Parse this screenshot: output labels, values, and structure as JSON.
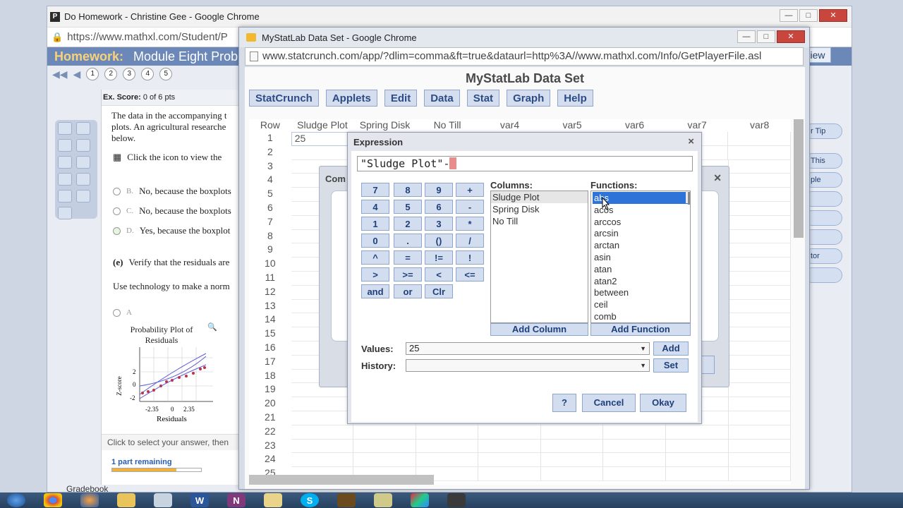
{
  "bg_window": {
    "title": "Do Homework - Christine Gee - Google Chrome",
    "favicon": "P",
    "url": "https://www.mathxl.com/Student/P",
    "hw_label": "Homework:",
    "hw_title": "Module Eight Probl",
    "nav_pages": [
      "1",
      "2",
      "3",
      "4",
      "5"
    ],
    "score_label": "Ex. Score:",
    "score_value": "0 of 6 pts",
    "problem_text": "The data in the accompanying t plots. An agricultural researche below.",
    "icon_text": "Click the icon to view the",
    "options": [
      {
        "letter": "B.",
        "text": "No, because the boxplots"
      },
      {
        "letter": "C.",
        "text": "No, because the boxplots"
      },
      {
        "letter": "D.",
        "text": "Yes, because the boxplot"
      }
    ],
    "part_e_label": "(e)",
    "part_e_text": "Verify that the residuals are",
    "use_tech_text": "Use technology to make a norm",
    "option_a": "A",
    "prob_plot_title": "Probability Plot of Residuals",
    "prob_plot_ylabel": "Z-score",
    "prob_plot_xlabel": "Residuals",
    "prob_plot_yticks": [
      "2",
      "0",
      "-2"
    ],
    "prob_plot_xticks": [
      "-2.35",
      "0",
      "2.35"
    ],
    "click_hint": "Click to select your answer, then",
    "progress_label": "1 part remaining",
    "progress_fraction": 0.72,
    "view_btn": "iew",
    "right_pills": [
      "r Tip",
      "This",
      "ple",
      "",
      "",
      "",
      "tor",
      ""
    ],
    "gradebook": "Gradebook"
  },
  "sc_window": {
    "title": "MyStatLab Data Set - Google Chrome",
    "url": "www.statcrunch.com/app/?dlim=comma&ft=true&dataurl=http%3A//www.mathxl.com/Info/GetPlayerFile.asl",
    "header": "MyStatLab Data Set",
    "menu": [
      "StatCrunch",
      "Applets",
      "Edit",
      "Data",
      "Stat",
      "Graph",
      "Help"
    ],
    "columns": [
      "Row",
      "Sludge Plot",
      "Spring Disk",
      "No Till",
      "var4",
      "var5",
      "var6",
      "var7",
      "var8"
    ],
    "rows": [
      "1",
      "2",
      "3",
      "4",
      "5",
      "6",
      "7",
      "8",
      "9",
      "10",
      "11",
      "12",
      "13",
      "14",
      "15",
      "16",
      "17",
      "18",
      "19",
      "20",
      "21",
      "22",
      "23",
      "24",
      "25"
    ],
    "row1_value": "25",
    "row2_partial": "2",
    "back_dialog_title": "Com"
  },
  "expression": {
    "title": "Expression",
    "close": "×",
    "text": "\"Sludge Plot\"-",
    "keypad": [
      [
        "7",
        "8",
        "9",
        "+"
      ],
      [
        "4",
        "5",
        "6",
        "-"
      ],
      [
        "1",
        "2",
        "3",
        "*"
      ],
      [
        "0",
        ".",
        "()",
        "/"
      ],
      [
        "^",
        "=",
        "!=",
        "!"
      ],
      [
        ">",
        ">=",
        "<",
        "<="
      ],
      [
        "and",
        "or",
        "Clr",
        ""
      ]
    ],
    "columns_label": "Columns:",
    "columns": [
      "Sludge Plot",
      "Spring Disk",
      "No Till"
    ],
    "functions_label": "Functions:",
    "functions": [
      "abs",
      "acos",
      "arccos",
      "arcsin",
      "arctan",
      "asin",
      "atan",
      "atan2",
      "between",
      "ceil",
      "comb"
    ],
    "add_column": "Add Column",
    "add_function": "Add Function",
    "values_label": "Values:",
    "values_value": "25",
    "history_label": "History:",
    "history_value": "",
    "add_btn": "Add",
    "set_btn": "Set",
    "help_btn": "?",
    "cancel_btn": "Cancel",
    "okay_btn": "Okay"
  },
  "taskbar": {
    "apps": [
      "start",
      "chrome",
      "firefox",
      "folder",
      "paint",
      "word",
      "onenote",
      "files",
      "skype",
      "app",
      "notes",
      "tools",
      "media"
    ]
  },
  "colors": {
    "accent": "#2d4c86",
    "button_bg": "#d2ddf0",
    "selection": "#2e73d8",
    "hw_bar": "#6b88b8"
  }
}
